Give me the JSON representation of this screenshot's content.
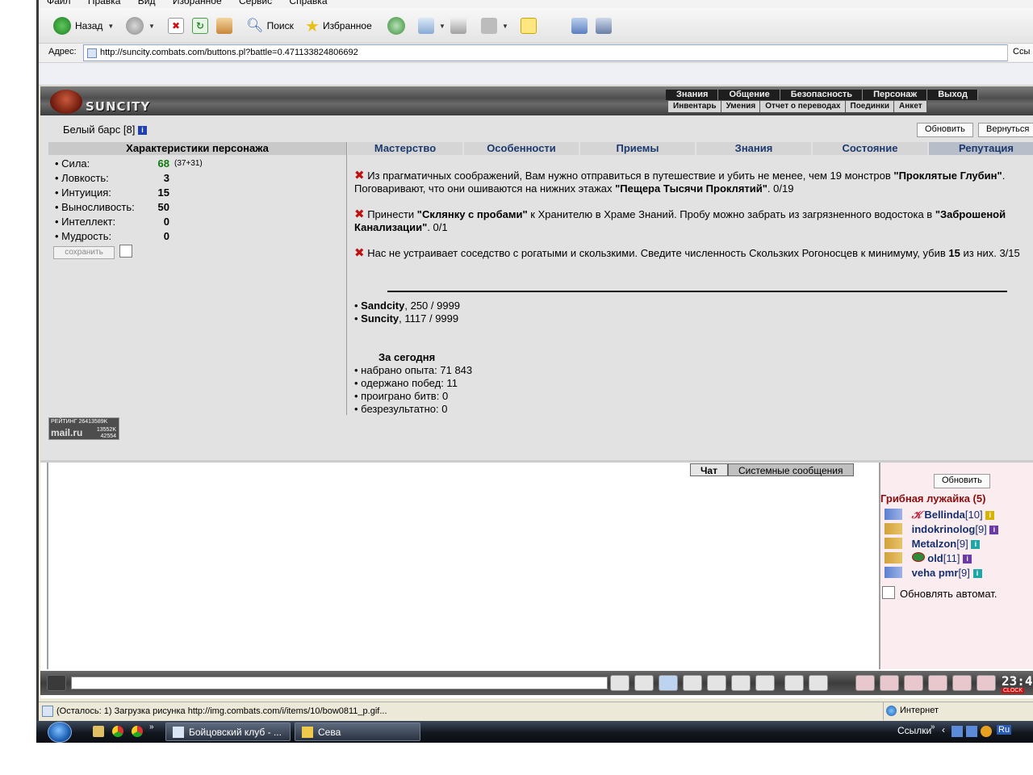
{
  "browser": {
    "menu": [
      "Файл",
      "Правка",
      "Вид",
      "Избранное",
      "Сервис",
      "Справка"
    ],
    "toolbar": {
      "back_label": "Назад",
      "search_label": "Поиск",
      "favorites_label": "Избранное"
    },
    "address_label": "Адрес:",
    "url": "http://suncity.combats.com/buttons.pl?battle=0.471133824806692",
    "go_label": "Ссы",
    "status_text": "(Осталось: 1) Загрузка рисунка http://img.combats.com/i/items/10/bow0811_p.gif...",
    "zone_label": "Интернет"
  },
  "site": {
    "logo": "SUNCITY",
    "top_nav": [
      "Знания",
      "Общение",
      "Безопасность",
      "Персонаж",
      "Выход"
    ],
    "sub_nav": [
      "Инвентарь",
      "Умения",
      "Отчет о переводах",
      "Поединки",
      "Анкет"
    ]
  },
  "character": {
    "name": "Белый барс",
    "level": "[8]",
    "refresh_label": "Обновить",
    "return_label": "Вернуться",
    "stats_title": "Характеристики персонажа",
    "stats": [
      {
        "label": "• Сила:",
        "value": "68",
        "extra": "(37+31)"
      },
      {
        "label": "• Ловкость:",
        "value": "3",
        "extra": ""
      },
      {
        "label": "• Интуиция:",
        "value": "15",
        "extra": ""
      },
      {
        "label": "• Выносливость:",
        "value": "50",
        "extra": ""
      },
      {
        "label": "• Интеллект:",
        "value": "0",
        "extra": ""
      },
      {
        "label": "• Мудрость:",
        "value": "0",
        "extra": ""
      }
    ],
    "save_label": "сохранить"
  },
  "tabs": [
    "Мастерство",
    "Особенности",
    "Приемы",
    "Знания",
    "Состояние",
    "Репутация"
  ],
  "quests": [
    {
      "pre": "Из прагматичных соображений, Вам нужно отправиться в путешествие и убить не менее, чем 19 монстров ",
      "b1": "\"Проклятые Глубин\"",
      "mid": ". Поговаривают, что они ошиваются на нижних этажах ",
      "b2": "\"Пещера Тысячи Проклятий\"",
      "post": ". 0/19"
    },
    {
      "pre": "Принести ",
      "b1": "\"Склянку с пробами\"",
      "mid": " к Хранителю в Храме Знаний. Пробу можно забрать из загрязненного водостока в ",
      "b2": "\"Заброшеной Канализации\"",
      "post": ". 0/1"
    },
    {
      "pre": "Нас не устраивает соседство с рогатыми и скользкими. Сведите численность Скользких Рогоносцев к минимуму, убив ",
      "b1": "15",
      "mid": " из них. 3/15",
      "b2": "",
      "post": ""
    }
  ],
  "reputation": [
    {
      "name": "Sandcity",
      "value": ", 250 / 9999"
    },
    {
      "name": "Suncity",
      "value": ", 1117 / 9999"
    }
  ],
  "today": {
    "title": "За сегодня",
    "items": [
      "• набрано опыта: 71 843",
      "• одержано побед: 11",
      "• проиграно битв: 0",
      "• безрезультатно: 0"
    ]
  },
  "rating": {
    "line1": "РЕЙТИНГ 26413589K",
    "line2": "mail.ru",
    "n1": "13552K",
    "n2": "42554"
  },
  "chat": {
    "tab_chat": "Чат",
    "tab_system": "Системные сообщения",
    "refresh_label": "Обновить",
    "room": "Грибная лужайка (5)",
    "users": [
      {
        "name": "Bellinda",
        "level": "[10]",
        "info_color": "#d6b400"
      },
      {
        "name": "indokrinolog",
        "level": "[9]",
        "info_color": "#6a3aa6"
      },
      {
        "name": "Metalzon",
        "level": "[9]",
        "info_color": "#1fa7a7"
      },
      {
        "name": "old",
        "level": "[11]",
        "info_color": "#6a3aa6"
      },
      {
        "name": "veha pmr",
        "level": "[9]",
        "info_color": "#1fa7a7"
      }
    ],
    "auto_label": "Обновлять автомат.",
    "clock": "23:4",
    "clock_sub": "CLOCK"
  },
  "taskbar": {
    "task1": "Бойцовский клуб - ...",
    "task2": "Сева",
    "links": "Ссылки",
    "lang": "Ru"
  },
  "colors": {
    "accent_red": "#c01111",
    "link_blue": "#1c3a6e",
    "room_red": "#8a0c0c"
  }
}
